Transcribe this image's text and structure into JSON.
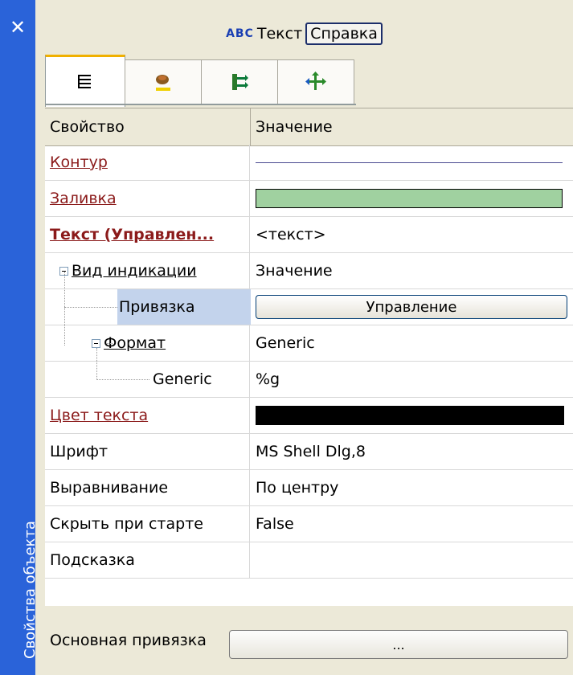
{
  "sidebar": {
    "close_glyph": "✕",
    "title": "Свойства объекта"
  },
  "header": {
    "icon_text": "ABC",
    "title": "Текст",
    "help_label": "Справка"
  },
  "tabs": [
    {
      "icon": "list-icon"
    },
    {
      "icon": "paint-icon"
    },
    {
      "icon": "link-icon"
    },
    {
      "icon": "move-icon"
    }
  ],
  "grid": {
    "col_property": "Свойство",
    "col_value": "Значение",
    "rows": {
      "contour": {
        "name": "Контур"
      },
      "fill": {
        "name": "Заливка",
        "color": "#a0d1a0"
      },
      "text": {
        "name": "Текст (Управлен...",
        "value": "<текст>"
      },
      "indication": {
        "name": "Вид индикации",
        "value": "Значение"
      },
      "binding": {
        "name": "Привязка",
        "value": "Управление"
      },
      "format": {
        "name": "Формат",
        "value": "Generic"
      },
      "generic": {
        "name": "Generic",
        "value": "%g"
      },
      "text_color": {
        "name": "Цвет текста",
        "color": "#000000"
      },
      "font": {
        "name": "Шрифт",
        "value": "MS Shell Dlg,8"
      },
      "align": {
        "name": "Выравнивание",
        "value": "По центру"
      },
      "hide": {
        "name": "Скрыть при старте",
        "value": "False"
      },
      "hint": {
        "name": "Подсказка",
        "value": ""
      }
    }
  },
  "footer": {
    "label": "Основная привязка",
    "button": "..."
  }
}
